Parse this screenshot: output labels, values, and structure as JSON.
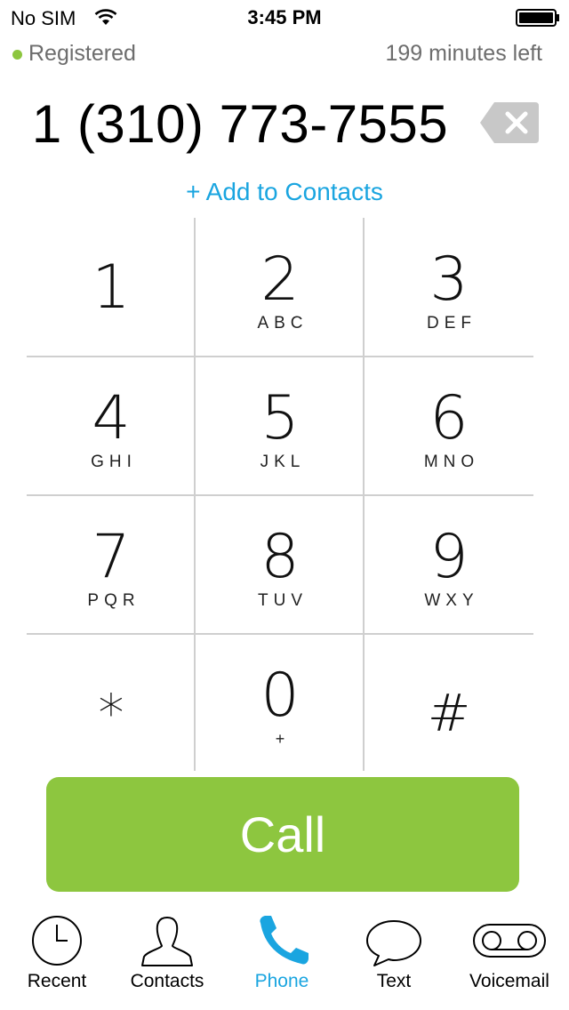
{
  "status_bar": {
    "carrier": "No SIM",
    "time": "3:45 PM",
    "wifi_icon": "wifi-icon",
    "battery_icon": "battery-icon"
  },
  "registration": {
    "status": "Registered",
    "status_color": "#8dc63f",
    "minutes_left": "199 minutes left"
  },
  "dialer": {
    "number": "1 (310) 773-7555",
    "backspace_icon": "backspace-icon",
    "add_to_contacts": "+ Add to Contacts"
  },
  "keypad": {
    "keys": [
      {
        "digit": "1",
        "letters": ""
      },
      {
        "digit": "2",
        "letters": "ABC"
      },
      {
        "digit": "3",
        "letters": "DEF"
      },
      {
        "digit": "4",
        "letters": "GHI"
      },
      {
        "digit": "5",
        "letters": "JKL"
      },
      {
        "digit": "6",
        "letters": "MNO"
      },
      {
        "digit": "7",
        "letters": "PQR"
      },
      {
        "digit": "8",
        "letters": "TUV"
      },
      {
        "digit": "9",
        "letters": "WXY"
      },
      {
        "digit": "*",
        "letters": ""
      },
      {
        "digit": "0",
        "letters": "+"
      },
      {
        "digit": "#",
        "letters": ""
      }
    ]
  },
  "call_button": {
    "label": "Call",
    "color": "#8dc63f"
  },
  "tab_bar": {
    "active_color": "#1aa5e0",
    "tabs": [
      {
        "label": "Recent",
        "icon": "clock-icon"
      },
      {
        "label": "Contacts",
        "icon": "person-icon"
      },
      {
        "label": "Phone",
        "icon": "phone-icon",
        "active": true
      },
      {
        "label": "Text",
        "icon": "speech-bubble-icon"
      },
      {
        "label": "Voicemail",
        "icon": "voicemail-icon"
      }
    ]
  }
}
